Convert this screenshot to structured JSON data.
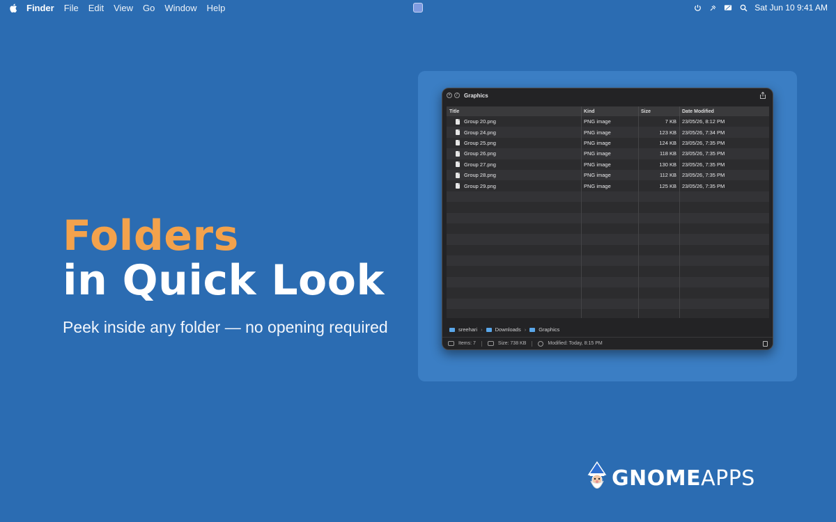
{
  "menubar": {
    "app_name": "Finder",
    "menus": [
      "File",
      "Edit",
      "View",
      "Go",
      "Window",
      "Help"
    ],
    "datetime": "Sat Jun 10  9:41 AM"
  },
  "headline": {
    "line1": "Folders",
    "line2": "in Quick Look",
    "subtitle": "Peek inside any folder — no opening required"
  },
  "colors": {
    "background": "#2b6cb2",
    "accent": "#f3a24c",
    "panel": "#3b7ec4",
    "window": "#232325"
  },
  "window": {
    "title": "Graphics",
    "columns": {
      "title": "Title",
      "kind": "Kind",
      "size": "Size",
      "date": "Date Modified"
    },
    "rows": [
      {
        "name": "Group 20.png",
        "kind": "PNG image",
        "size": "7 KB",
        "date": "23/05/26, 8:12 PM"
      },
      {
        "name": "Group 24.png",
        "kind": "PNG image",
        "size": "123 KB",
        "date": "23/05/26, 7:34 PM"
      },
      {
        "name": "Group 25.png",
        "kind": "PNG image",
        "size": "124 KB",
        "date": "23/05/26, 7:35 PM"
      },
      {
        "name": "Group 26.png",
        "kind": "PNG image",
        "size": "118 KB",
        "date": "23/05/26, 7:35 PM"
      },
      {
        "name": "Group 27.png",
        "kind": "PNG image",
        "size": "130 KB",
        "date": "23/05/26, 7:35 PM"
      },
      {
        "name": "Group 28.png",
        "kind": "PNG image",
        "size": "112 KB",
        "date": "23/05/26, 7:35 PM"
      },
      {
        "name": "Group 29.png",
        "kind": "PNG image",
        "size": "125 KB",
        "date": "23/05/26, 7:35 PM"
      }
    ],
    "path": [
      "sreehari",
      "Downloads",
      "Graphics"
    ],
    "status": {
      "items": "Items: 7",
      "size": "Size: 738 KB",
      "modified": "Modified: Today, 8:15 PM"
    }
  },
  "logo": {
    "part1": "GNOME",
    "part2": "APPS"
  }
}
